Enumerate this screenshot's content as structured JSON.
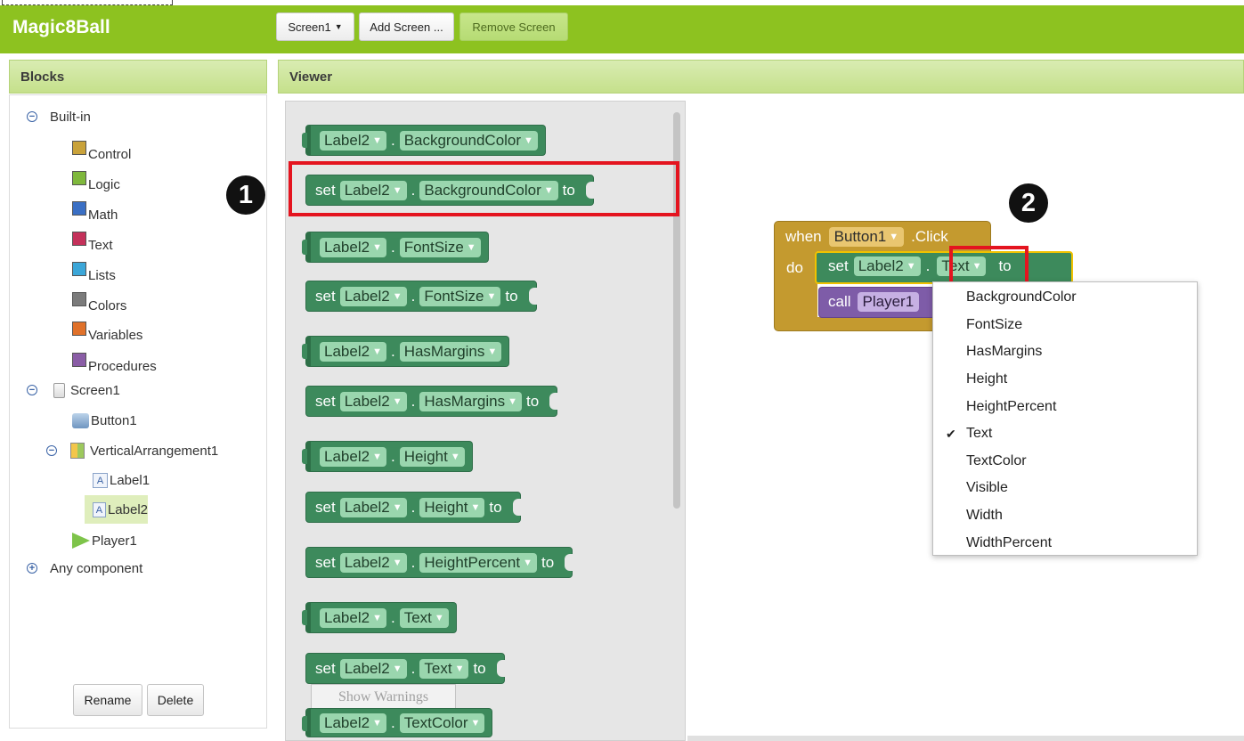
{
  "app": {
    "title": "Magic8Ball"
  },
  "toolbar": {
    "screen_select": "Screen1",
    "add_screen": "Add Screen ...",
    "remove_screen": "Remove Screen"
  },
  "panels": {
    "blocks_title": "Blocks",
    "viewer_title": "Viewer"
  },
  "tree": {
    "builtin": "Built-in",
    "builtin_items": [
      {
        "label": "Control",
        "color": "#c9a23a"
      },
      {
        "label": "Logic",
        "color": "#7fb83c"
      },
      {
        "label": "Math",
        "color": "#3a6fc4"
      },
      {
        "label": "Text",
        "color": "#c4315a"
      },
      {
        "label": "Lists",
        "color": "#3ba6d8"
      },
      {
        "label": "Colors",
        "color": "#7b7b7b"
      },
      {
        "label": "Variables",
        "color": "#e0712a"
      },
      {
        "label": "Procedures",
        "color": "#8a5da6"
      }
    ],
    "screen": "Screen1",
    "button": "Button1",
    "arrangement": "VerticalArrangement1",
    "label1": "Label1",
    "label2": "Label2",
    "player": "Player1",
    "any_component": "Any component"
  },
  "actions": {
    "rename": "Rename",
    "delete": "Delete"
  },
  "flyout": {
    "component": "Label2",
    "set_kw": "set",
    "to_kw": "to",
    "dot": ".",
    "props": {
      "bgcolor": "BackgroundColor",
      "fontsize": "FontSize",
      "hasmargins": "HasMargins",
      "height": "Height",
      "heightpercent": "HeightPercent",
      "text": "Text",
      "textcolor": "TextColor"
    },
    "show_warnings": "Show Warnings"
  },
  "workspace": {
    "when_kw": "when",
    "do_kw": "do",
    "event_component": "Button1",
    "event_name": ".Click",
    "set_kw": "set",
    "set_component": "Label2",
    "dot": ".",
    "set_property": "Text",
    "to_kw": "to",
    "call_kw": "call",
    "call_component": "Player1"
  },
  "property_menu": {
    "items": [
      "BackgroundColor",
      "FontSize",
      "HasMargins",
      "Height",
      "HeightPercent",
      "Text",
      "TextColor",
      "Visible",
      "Width",
      "WidthPercent"
    ],
    "checked": "Text",
    "check_glyph": "✔"
  },
  "annotations": {
    "step1": "1",
    "step2": "2"
  },
  "colors": {
    "brand_green": "#8dc220",
    "block_green": "#3d8a5c",
    "event_gold": "#c49a2f",
    "highlight_red": "#e4141f"
  }
}
